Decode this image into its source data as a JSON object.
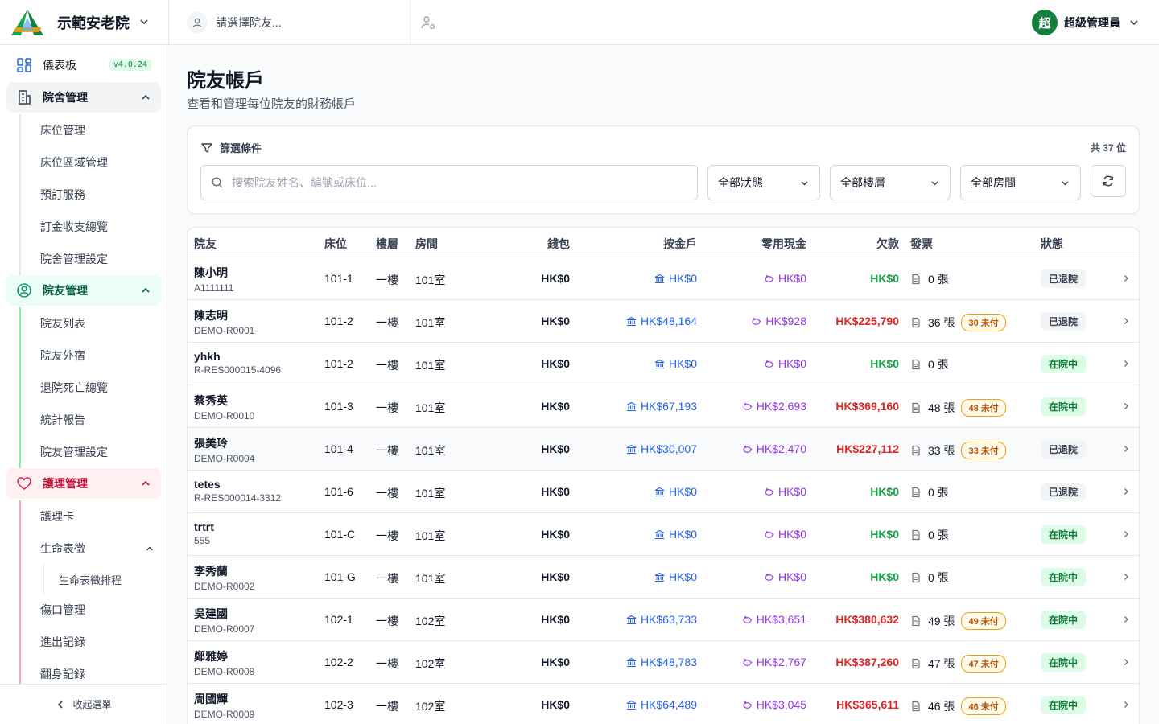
{
  "app": {
    "name": "示範安老院",
    "version": "v4.0.24"
  },
  "header": {
    "resident_placeholder": "請選擇院友...",
    "user_initial": "超",
    "user_name": "超級管理員"
  },
  "sidebar": {
    "dashboard": "儀表板",
    "sections": [
      {
        "label": "院舍管理",
        "items": [
          "床位管理",
          "床位區域管理",
          "預訂服務",
          "訂金收支總覽",
          "院舍管理設定"
        ]
      },
      {
        "label": "院友管理",
        "items": [
          "院友列表",
          "院友外宿",
          "退院死亡總覽",
          "統計報告",
          "院友管理設定"
        ]
      },
      {
        "label": "護理管理",
        "items": [
          "護理卡",
          "生命表徵",
          "傷口管理",
          "進出記錄",
          "翻身記錄"
        ],
        "nested": "生命表徵排程"
      }
    ],
    "collapse_label": "收起選單"
  },
  "page": {
    "title": "院友帳戶",
    "subtitle": "查看和管理每位院友的財務帳戶"
  },
  "filters": {
    "title": "篩選條件",
    "count": "共 37 位",
    "search_placeholder": "搜索院友姓名、編號或床位...",
    "status": "全部狀態",
    "floor": "全部樓層",
    "room": "全部房間"
  },
  "table": {
    "headers": {
      "resident": "院友",
      "bed": "床位",
      "floor": "樓層",
      "room": "房間",
      "wallet": "錢包",
      "trust": "按金戶",
      "petty": "零用現金",
      "debt": "欠款",
      "invoice": "發票",
      "status": "狀態"
    },
    "rows": [
      {
        "name": "陳小明",
        "code": "A1111111",
        "bed": "101-1",
        "floor": "一樓",
        "room": "101室",
        "wallet": "HK$0",
        "trust": "HK$0",
        "petty": "HK$0",
        "debt": "HK$0",
        "debt_zero": true,
        "invoices": "0 張",
        "unpaid": "",
        "status": "已退院",
        "in": false
      },
      {
        "name": "陳志明",
        "code": "DEMO-R0001",
        "bed": "101-2",
        "floor": "一樓",
        "room": "101室",
        "wallet": "HK$0",
        "trust": "HK$48,164",
        "petty": "HK$928",
        "debt": "HK$225,790",
        "debt_zero": false,
        "invoices": "36 張",
        "unpaid": "30 未付",
        "status": "已退院",
        "in": false
      },
      {
        "name": "yhkh",
        "code": "R-RES000015-4096",
        "bed": "101-2",
        "floor": "一樓",
        "room": "101室",
        "wallet": "HK$0",
        "trust": "HK$0",
        "petty": "HK$0",
        "debt": "HK$0",
        "debt_zero": true,
        "invoices": "0 張",
        "unpaid": "",
        "status": "在院中",
        "in": true
      },
      {
        "name": "蔡秀英",
        "code": "DEMO-R0010",
        "bed": "101-3",
        "floor": "一樓",
        "room": "101室",
        "wallet": "HK$0",
        "trust": "HK$67,193",
        "petty": "HK$2,693",
        "debt": "HK$369,160",
        "debt_zero": false,
        "invoices": "48 張",
        "unpaid": "48 未付",
        "status": "在院中",
        "in": true
      },
      {
        "name": "張美玲",
        "code": "DEMO-R0004",
        "bed": "101-4",
        "floor": "一樓",
        "room": "101室",
        "wallet": "HK$0",
        "trust": "HK$30,007",
        "petty": "HK$2,470",
        "debt": "HK$227,112",
        "debt_zero": false,
        "invoices": "33 張",
        "unpaid": "33 未付",
        "status": "已退院",
        "in": false
      },
      {
        "name": "tetes",
        "code": "R-RES000014-3312",
        "bed": "101-6",
        "floor": "一樓",
        "room": "101室",
        "wallet": "HK$0",
        "trust": "HK$0",
        "petty": "HK$0",
        "debt": "HK$0",
        "debt_zero": true,
        "invoices": "0 張",
        "unpaid": "",
        "status": "已退院",
        "in": false
      },
      {
        "name": "trtrt",
        "code": "555",
        "bed": "101-C",
        "floor": "一樓",
        "room": "101室",
        "wallet": "HK$0",
        "trust": "HK$0",
        "petty": "HK$0",
        "debt": "HK$0",
        "debt_zero": true,
        "invoices": "0 張",
        "unpaid": "",
        "status": "在院中",
        "in": true
      },
      {
        "name": "李秀蘭",
        "code": "DEMO-R0002",
        "bed": "101-G",
        "floor": "一樓",
        "room": "101室",
        "wallet": "HK$0",
        "trust": "HK$0",
        "petty": "HK$0",
        "debt": "HK$0",
        "debt_zero": true,
        "invoices": "0 張",
        "unpaid": "",
        "status": "在院中",
        "in": true
      },
      {
        "name": "吳建國",
        "code": "DEMO-R0007",
        "bed": "102-1",
        "floor": "一樓",
        "room": "102室",
        "wallet": "HK$0",
        "trust": "HK$63,733",
        "petty": "HK$3,651",
        "debt": "HK$380,632",
        "debt_zero": false,
        "invoices": "49 張",
        "unpaid": "49 未付",
        "status": "在院中",
        "in": true
      },
      {
        "name": "鄭雅婷",
        "code": "DEMO-R0008",
        "bed": "102-2",
        "floor": "一樓",
        "room": "102室",
        "wallet": "HK$0",
        "trust": "HK$48,783",
        "petty": "HK$2,767",
        "debt": "HK$387,260",
        "debt_zero": false,
        "invoices": "47 張",
        "unpaid": "47 未付",
        "status": "在院中",
        "in": true
      },
      {
        "name": "周國輝",
        "code": "DEMO-R0009",
        "bed": "102-3",
        "floor": "一樓",
        "room": "102室",
        "wallet": "HK$0",
        "trust": "HK$64,489",
        "petty": "HK$3,045",
        "debt": "HK$365,611",
        "debt_zero": false,
        "invoices": "46 張",
        "unpaid": "46 未付",
        "status": "在院中",
        "in": true
      }
    ]
  },
  "colors": {
    "accent": "#15803d",
    "trust": "#2563eb",
    "petty": "#9333ea",
    "debt": "#dc2626",
    "zero": "#16a34a",
    "nursing": "#be123c"
  }
}
